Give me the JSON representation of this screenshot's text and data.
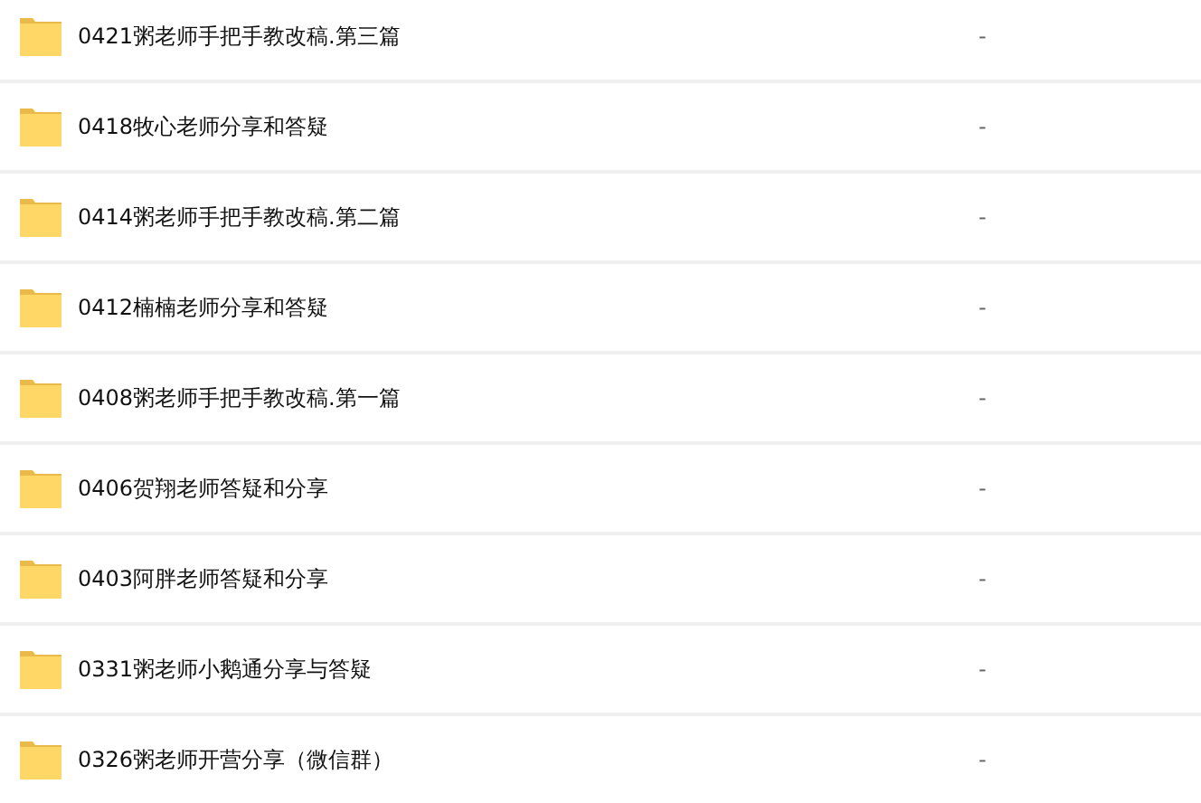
{
  "files": [
    {
      "name": "0421粥老师手把手教改稿.第三篇",
      "size": "-"
    },
    {
      "name": "0418牧心老师分享和答疑",
      "size": "-"
    },
    {
      "name": "0414粥老师手把手教改稿.第二篇",
      "size": "-"
    },
    {
      "name": "0412楠楠老师分享和答疑",
      "size": "-"
    },
    {
      "name": "0408粥老师手把手教改稿.第一篇",
      "size": "-"
    },
    {
      "name": "0406贺翔老师答疑和分享",
      "size": "-"
    },
    {
      "name": "0403阿胖老师答疑和分享",
      "size": "-"
    },
    {
      "name": "0331粥老师小鹅通分享与答疑",
      "size": "-"
    },
    {
      "name": "0326粥老师开营分享（微信群）",
      "size": "-"
    }
  ]
}
